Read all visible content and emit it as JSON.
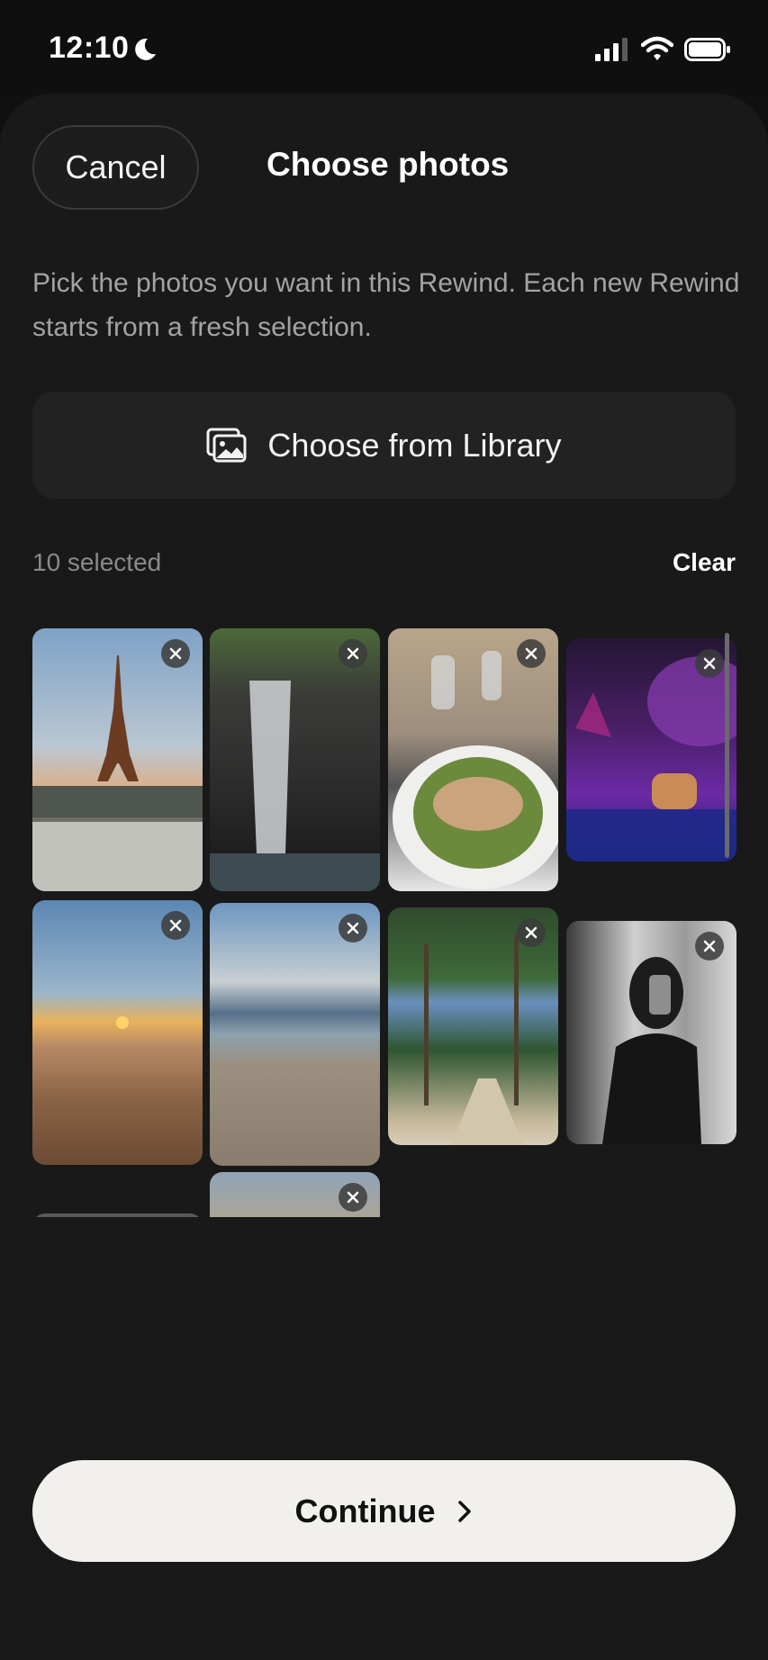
{
  "status_bar": {
    "time": "12:10"
  },
  "header": {
    "cancel_label": "Cancel",
    "title": "Choose photos"
  },
  "description": "Pick the photos you want in this Rewind. Each new Rewind starts from a fresh selection.",
  "library_button": {
    "label": "Choose from Library",
    "icon": "photo-library-icon"
  },
  "selection": {
    "count_text": "10 selected",
    "clear_label": "Clear"
  },
  "photos": [
    {
      "name": "photo-eiffel-tower",
      "remove_icon": "close-icon"
    },
    {
      "name": "photo-waterfall",
      "remove_icon": "close-icon"
    },
    {
      "name": "photo-salad-table",
      "remove_icon": "close-icon"
    },
    {
      "name": "photo-neon-venue",
      "remove_icon": "close-icon"
    },
    {
      "name": "photo-sunset-beach-path",
      "remove_icon": "close-icon"
    },
    {
      "name": "photo-beach-waves",
      "remove_icon": "close-icon"
    },
    {
      "name": "photo-palm-trees",
      "remove_icon": "close-icon"
    },
    {
      "name": "photo-mirror-selfie",
      "remove_icon": "close-icon"
    },
    {
      "name": "photo-partial-row3-a",
      "remove_icon": "close-icon"
    },
    {
      "name": "photo-partial-row3-b",
      "remove_icon": "close-icon"
    }
  ],
  "footer": {
    "continue_label": "Continue",
    "icon": "chevron-right-icon"
  },
  "colors": {
    "background": "#101010",
    "sheet": "#191919",
    "continue_bg": "#f1f0ec"
  }
}
